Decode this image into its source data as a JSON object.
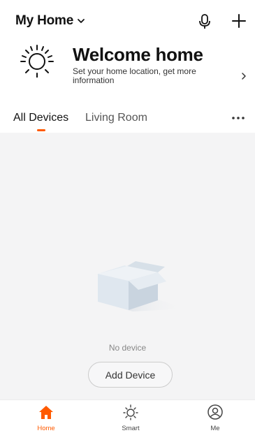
{
  "header": {
    "home_name": "My Home"
  },
  "welcome": {
    "title": "Welcome home",
    "subtitle": "Set your home location, get more information"
  },
  "tabs": [
    {
      "label": "All Devices",
      "active": true
    },
    {
      "label": "Living Room",
      "active": false
    }
  ],
  "empty_state": {
    "message": "No device",
    "button_label": "Add Device"
  },
  "bottom_nav": [
    {
      "label": "Home",
      "icon": "home-icon",
      "active": true
    },
    {
      "label": "Smart",
      "icon": "sun-icon",
      "active": false
    },
    {
      "label": "Me",
      "icon": "user-icon",
      "active": false
    }
  ],
  "colors": {
    "accent": "#ff5a00",
    "background": "#f4f4f5"
  }
}
